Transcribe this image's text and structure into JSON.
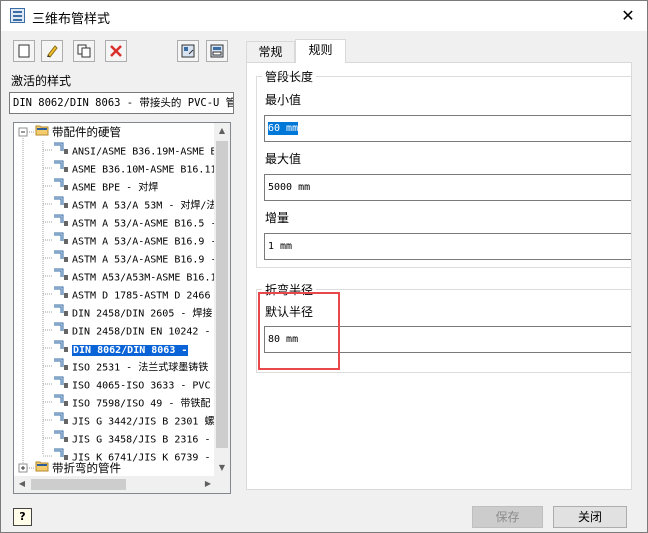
{
  "window": {
    "title": "三维布管样式"
  },
  "left": {
    "active_style_label": "激活的样式",
    "active_style_value": "DIN 8062/DIN 8063 - 带接头的 PVC-U 管",
    "tree": {
      "root1": "带配件的硬管",
      "items": [
        "ANSI/ASME B36.19M-ASME B",
        "ASME B36.10M-ASME B16.11",
        "ASME BPE - 对焊",
        "ASTM A 53/A 53M - 对焊/法",
        "ASTM A 53/A-ASME B16.5 -",
        "ASTM A 53/A-ASME B16.9 -",
        "ASTM A 53/A-ASME B16.9 -",
        "ASTM A53/A53M-ASME B16.1",
        "ASTM D 1785-ASTM D 2466",
        "DIN 2458/DIN 2605 - 焊接",
        "DIN 2458/DIN EN 10242 -",
        "DIN 8062/DIN 8063 -",
        "ISO 2531 - 法兰式球墨铸铁",
        "ISO 4065-ISO 3633 - PVC",
        "ISO 7598/ISO 49 - 带铁配",
        "JIS G 3442/JIS B 2301 螺",
        "JIS G 3458/JIS B 2316 -",
        "JIS K 6741/JIS K 6739 -"
      ],
      "selected_index": 11,
      "root2": "带折弯的管件"
    }
  },
  "tabs": [
    "常规",
    "规则"
  ],
  "rules": {
    "segment_group": "管段长度",
    "min_label": "最小值",
    "min_value": "60 mm",
    "max_label": "最大值",
    "max_value": "5000 mm",
    "inc_label": "增量",
    "inc_value": "1 mm",
    "bend_group": "折弯半径",
    "default_radius_label": "默认半径",
    "default_radius_value": "80 mm"
  },
  "buttons": {
    "save": "保存",
    "close": "关闭",
    "help": "?"
  },
  "colors": {
    "selection": "#0a64d8",
    "highlight_box": "#e8474b",
    "delete_icon": "#d9302c"
  }
}
